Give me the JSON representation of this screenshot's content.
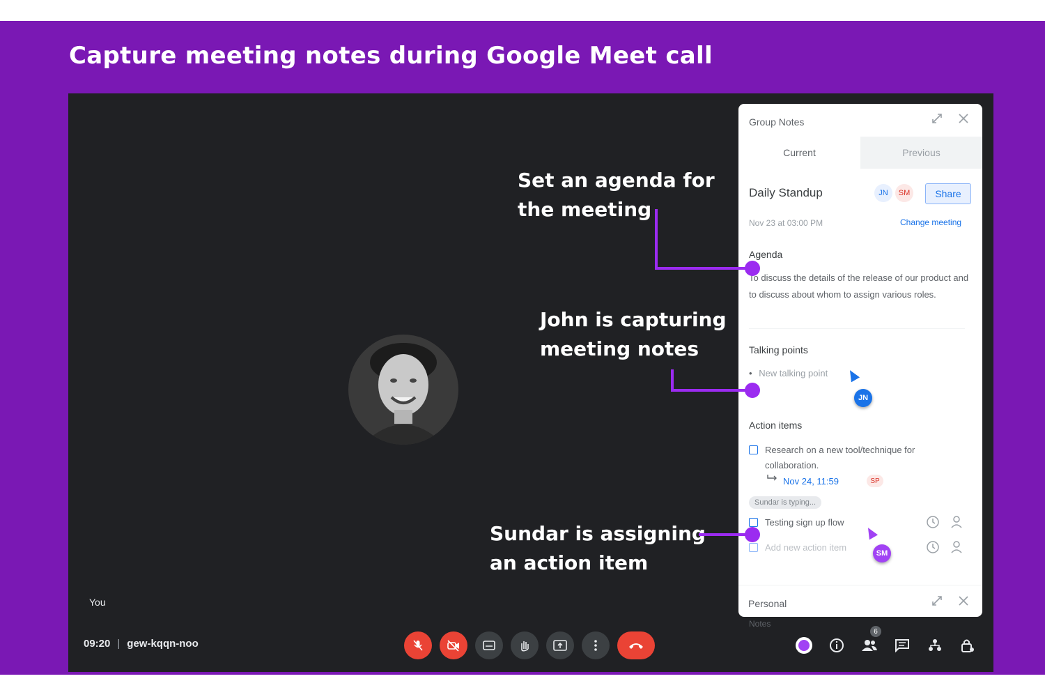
{
  "headline": "Capture meeting notes during Google Meet call",
  "meet": {
    "self_label": "You",
    "time": "09:20",
    "separator": "|",
    "meeting_code": "gew-kqqn-noo",
    "participants_badge": "6"
  },
  "panel": {
    "title": "Group Notes",
    "tabs": [
      "Current",
      "Previous"
    ],
    "meeting_title": "Daily Standup",
    "avatars": [
      "JN",
      "SM"
    ],
    "share_label": "Share",
    "date": "Nov 23 at 03:00 PM",
    "change_meeting": "Change meeting",
    "agenda_heading": "Agenda",
    "agenda_text": "To discuss the details of the release of our product and to discuss about whom to assign various roles.",
    "talking_points_heading": "Talking points",
    "talking_point_placeholder": "New talking point",
    "john_cursor": "JN",
    "action_items_heading": "Action items",
    "action_item_1": "Research on a new tool/technique for collaboration.",
    "action_item_1_due": "Nov 24, 11:59",
    "action_item_1_owner": "SP",
    "typing_indicator": "Sundar is typing...",
    "action_item_2": "Testing sign up flow",
    "action_item_placeholder": "Add new action item",
    "sundar_cursor": "SM",
    "personal_title": "Personal",
    "personal_notes_peek": "Notes"
  },
  "callouts": {
    "agenda_line1": "Set an agenda for",
    "agenda_line2": "the meeting",
    "notes_line1": "John is capturing",
    "notes_line2": "meeting notes",
    "action_line1": "Sundar is assigning",
    "action_line2": "an action item"
  },
  "colors": {
    "banner": "#7a18b4",
    "meet_background": "#202124",
    "connector": "#9b2bf0",
    "end_call": "#ea4335",
    "accent_blue": "#1a73e8"
  },
  "icons": [
    "mic-off-icon",
    "camera-off-icon",
    "captions-icon",
    "raise-hand-icon",
    "present-icon",
    "more-icon",
    "end-call-icon",
    "emoji-icon",
    "info-icon",
    "people-icon",
    "chat-icon",
    "activities-icon",
    "lock-icon",
    "expand-icon",
    "close-icon",
    "clock-icon",
    "assign-person-icon"
  ]
}
